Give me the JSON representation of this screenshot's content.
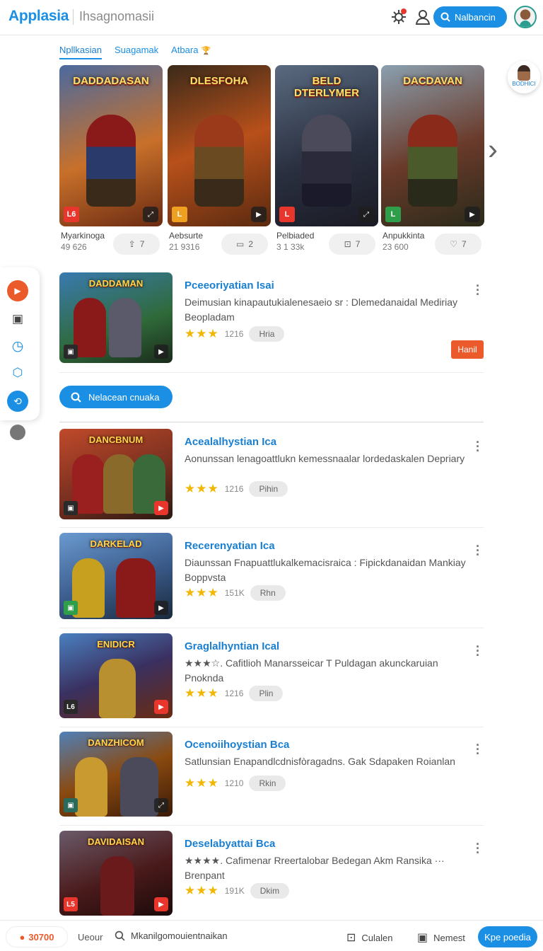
{
  "header": {
    "brand": "Applasia",
    "subtitle": "Ihsagnomasii",
    "search_label": "Nalbancin"
  },
  "tabs": [
    {
      "label": "Npllkasian",
      "active": true
    },
    {
      "label": "Suagamak",
      "active": false
    },
    {
      "label": "Atbara",
      "active": false,
      "extra": "🏆"
    }
  ],
  "float_profile": {
    "label": "BODHICI"
  },
  "featured": [
    {
      "art_title": "DADDADASAN",
      "name": "Myarkinoga",
      "count": "49 626",
      "action_icon": "share-icon",
      "action_count": "7",
      "badge": "L6",
      "badge_color": "#e8362d",
      "accent": "#c0392b"
    },
    {
      "art_title": "DLESFOHA",
      "name": "Aebsurte",
      "count": "21 9316",
      "action_icon": "message-icon",
      "action_count": "2",
      "badge": "L",
      "badge_color": "#f0a020",
      "accent": "#8e3b1d"
    },
    {
      "art_title": "BELD DTERLYMER",
      "name": "Pelbiaded",
      "count": "3 1 33k",
      "action_icon": "download-icon",
      "action_count": "7",
      "badge": "L",
      "badge_color": "#e8362d",
      "accent": "#3a4a5a"
    },
    {
      "art_title": "DACDAVAN",
      "name": "Anpukkinta",
      "count": "23 600",
      "action_icon": "heart-icon",
      "action_count": "7",
      "badge": "L",
      "badge_color": "#2e9e4a",
      "accent": "#7a2a1a"
    }
  ],
  "list": [
    {
      "title": "Pceeoriyatian Isai",
      "desc": "Deimusian kinapautukialenesaeio sr : Dlemedanaidal Mediriay Beopladam",
      "stars": 3,
      "count": "1216",
      "pill": "Hria",
      "hot_label": "Hanil",
      "art": "DADDAMAN",
      "bg": "#2f6a3a"
    },
    {
      "title": "Acealalhystian Ica",
      "desc": "Aonunssan lenagoattlukn kemessnaalar lordedaskalen Depriary",
      "stars": 3,
      "count": "1216",
      "pill": "Pihin",
      "art": "DANCBNUM",
      "bg": "#7a3020"
    },
    {
      "title": "Recerenyatian Ica",
      "desc": "Diaunssan Fnapuattlukalkemacisraica : Fipickdanaidan Mankiay Boppvsta",
      "stars": 3,
      "count": "151K",
      "pill": "Rhn",
      "art": "DARKELAD",
      "bg": "#3a5a8a"
    },
    {
      "title": "Graglalhyntian Ical",
      "desc": "★★★☆. Cafitlioh Manarsseicar T Puldagan akunckaruian Pnoknda",
      "stars": 3,
      "count": "1216",
      "pill": "Plin",
      "art": "ENIDICR",
      "bg": "#3a3060"
    },
    {
      "title": "Ocenoiihoystian Bca",
      "desc": "Satlunsian Enapandlcdnisfòragadns. Gak Sdapaken Roianlan",
      "stars": 3,
      "count": "1210",
      "pill": "Rkin",
      "art": "DANZHICOM",
      "bg": "#8a4a10"
    },
    {
      "title": "Deselabyattai Bca",
      "desc": "★★★★. Cafimenar Rreertalobar Bedegan Akm Ransika ··· Brenpant",
      "stars": 3,
      "count": "191K",
      "pill": "Dkim",
      "art": "DAVIDAISAN",
      "bg": "#4a1a1a"
    }
  ],
  "search_button": "Nelacean cnuaka",
  "bottom": {
    "points": "30700",
    "label_1": "Ueour",
    "search_text": "Mkanilgomouientnaikan",
    "item_1": "Culalen",
    "item_2": "Nemest",
    "cta": "Kpe poedia"
  }
}
